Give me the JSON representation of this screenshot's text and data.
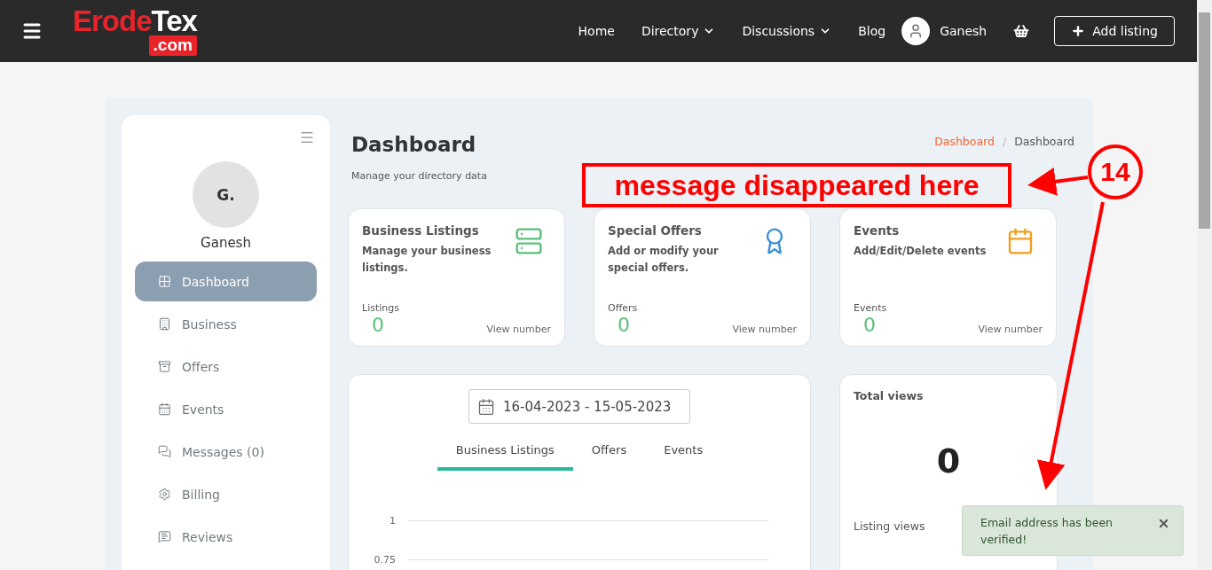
{
  "header": {
    "logo_main": "Erode",
    "logo_accent": "Tex",
    "logo_domain": ".com",
    "nav": [
      {
        "label": "Home",
        "dropdown": false
      },
      {
        "label": "Directory",
        "dropdown": true
      },
      {
        "label": "Discussions",
        "dropdown": true
      },
      {
        "label": "Blog",
        "dropdown": false
      }
    ],
    "user": "Ganesh",
    "add_button": "Add listing"
  },
  "sidebar": {
    "initials": "G.",
    "name": "Ganesh",
    "items": [
      {
        "label": "Dashboard",
        "selected": true
      },
      {
        "label": "Business",
        "selected": false
      },
      {
        "label": "Offers",
        "selected": false
      },
      {
        "label": "Events",
        "selected": false
      },
      {
        "label": "Messages (0)",
        "selected": false
      },
      {
        "label": "Billing",
        "selected": false
      },
      {
        "label": "Reviews",
        "selected": false
      }
    ]
  },
  "page": {
    "title": "Dashboard",
    "subtitle": "Manage your directory data",
    "breadcrumb_separator": "/",
    "breadcrumb": [
      {
        "label": "Dashboard",
        "kind": "link"
      },
      {
        "label": "Dashboard",
        "kind": "current"
      }
    ]
  },
  "cards": [
    {
      "title": "Business Listings",
      "description": "Manage your business listings.",
      "stat_label": "Listings",
      "value": "0",
      "link": "View number",
      "color": "#5cbf7a"
    },
    {
      "title": "Special Offers",
      "description": "Add or modify your special offers.",
      "stat_label": "Offers",
      "value": "0",
      "link": "View number",
      "color": "#3a8fd8"
    },
    {
      "title": "Events",
      "description": "Add/Edit/Delete events",
      "stat_label": "Events",
      "value": "0",
      "link": "View number",
      "color": "#f0a020"
    }
  ],
  "chart_panel": {
    "date_range": "16-04-2023 - 15-05-2023",
    "tabs": [
      {
        "label": "Business Listings",
        "selected": true
      },
      {
        "label": "Offers",
        "selected": false
      },
      {
        "label": "Events",
        "selected": false
      }
    ],
    "y_labels": [
      "1",
      "0.75"
    ]
  },
  "total_views": {
    "title": "Total views",
    "value": "0",
    "listing_views": "Listing views"
  },
  "toast": {
    "message": "Email address has been verified!"
  },
  "annotation": {
    "text": "message disappeared here",
    "number": "14"
  }
}
